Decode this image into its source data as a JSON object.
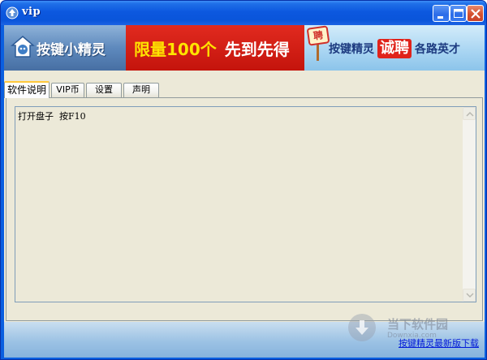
{
  "window": {
    "title": "vip"
  },
  "banner": {
    "left_text": "按键小精灵",
    "mid_text_yellow": "限量100个",
    "mid_text_white": "先到先得",
    "sign_text": "聘",
    "right_text_a": "按键精灵",
    "right_text_hire": "诚聘",
    "right_text_b": "各路英才"
  },
  "tabs": [
    {
      "label": "软件说明",
      "active": true
    },
    {
      "label": "VIP币",
      "active": false
    },
    {
      "label": "设置",
      "active": false
    },
    {
      "label": "声明",
      "active": false
    }
  ],
  "main": {
    "text_content": "打开盘子  按F10"
  },
  "footer": {
    "link_text": "按键精灵最新版下载",
    "watermark_text": "当下软件园",
    "watermark_sub": "Downxia.com"
  },
  "colors": {
    "title_bar": "#0a55da",
    "client_bg": "#ece9d8",
    "link": "#0018d8"
  }
}
